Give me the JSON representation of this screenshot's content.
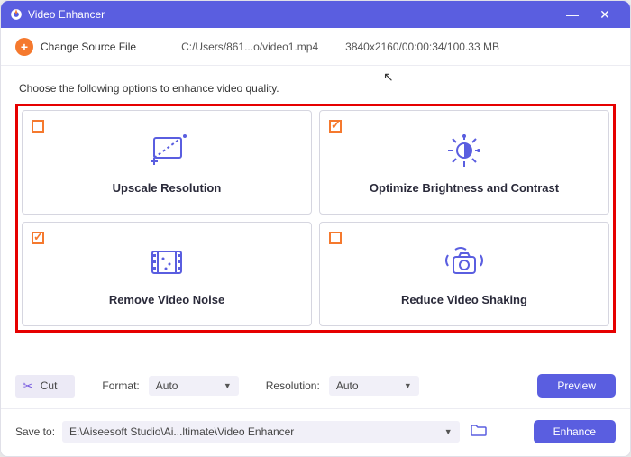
{
  "window": {
    "title": "Video Enhancer"
  },
  "source": {
    "change_label": "Change Source File",
    "path": "C:/Users/861...o/video1.mp4",
    "info": "3840x2160/00:00:34/100.33 MB"
  },
  "hint": "Choose the following options to enhance video quality.",
  "options": {
    "upscale": {
      "label": "Upscale Resolution",
      "checked": false
    },
    "brightness": {
      "label": "Optimize Brightness and Contrast",
      "checked": true
    },
    "noise": {
      "label": "Remove Video Noise",
      "checked": true
    },
    "shaking": {
      "label": "Reduce Video Shaking",
      "checked": false
    }
  },
  "toolbar": {
    "cut_label": "Cut",
    "format_label": "Format:",
    "format_value": "Auto",
    "resolution_label": "Resolution:",
    "resolution_value": "Auto",
    "preview_label": "Preview"
  },
  "bottom": {
    "save_label": "Save to:",
    "save_path": "E:\\Aiseesoft Studio\\Ai...ltimate\\Video Enhancer",
    "enhance_label": "Enhance"
  }
}
